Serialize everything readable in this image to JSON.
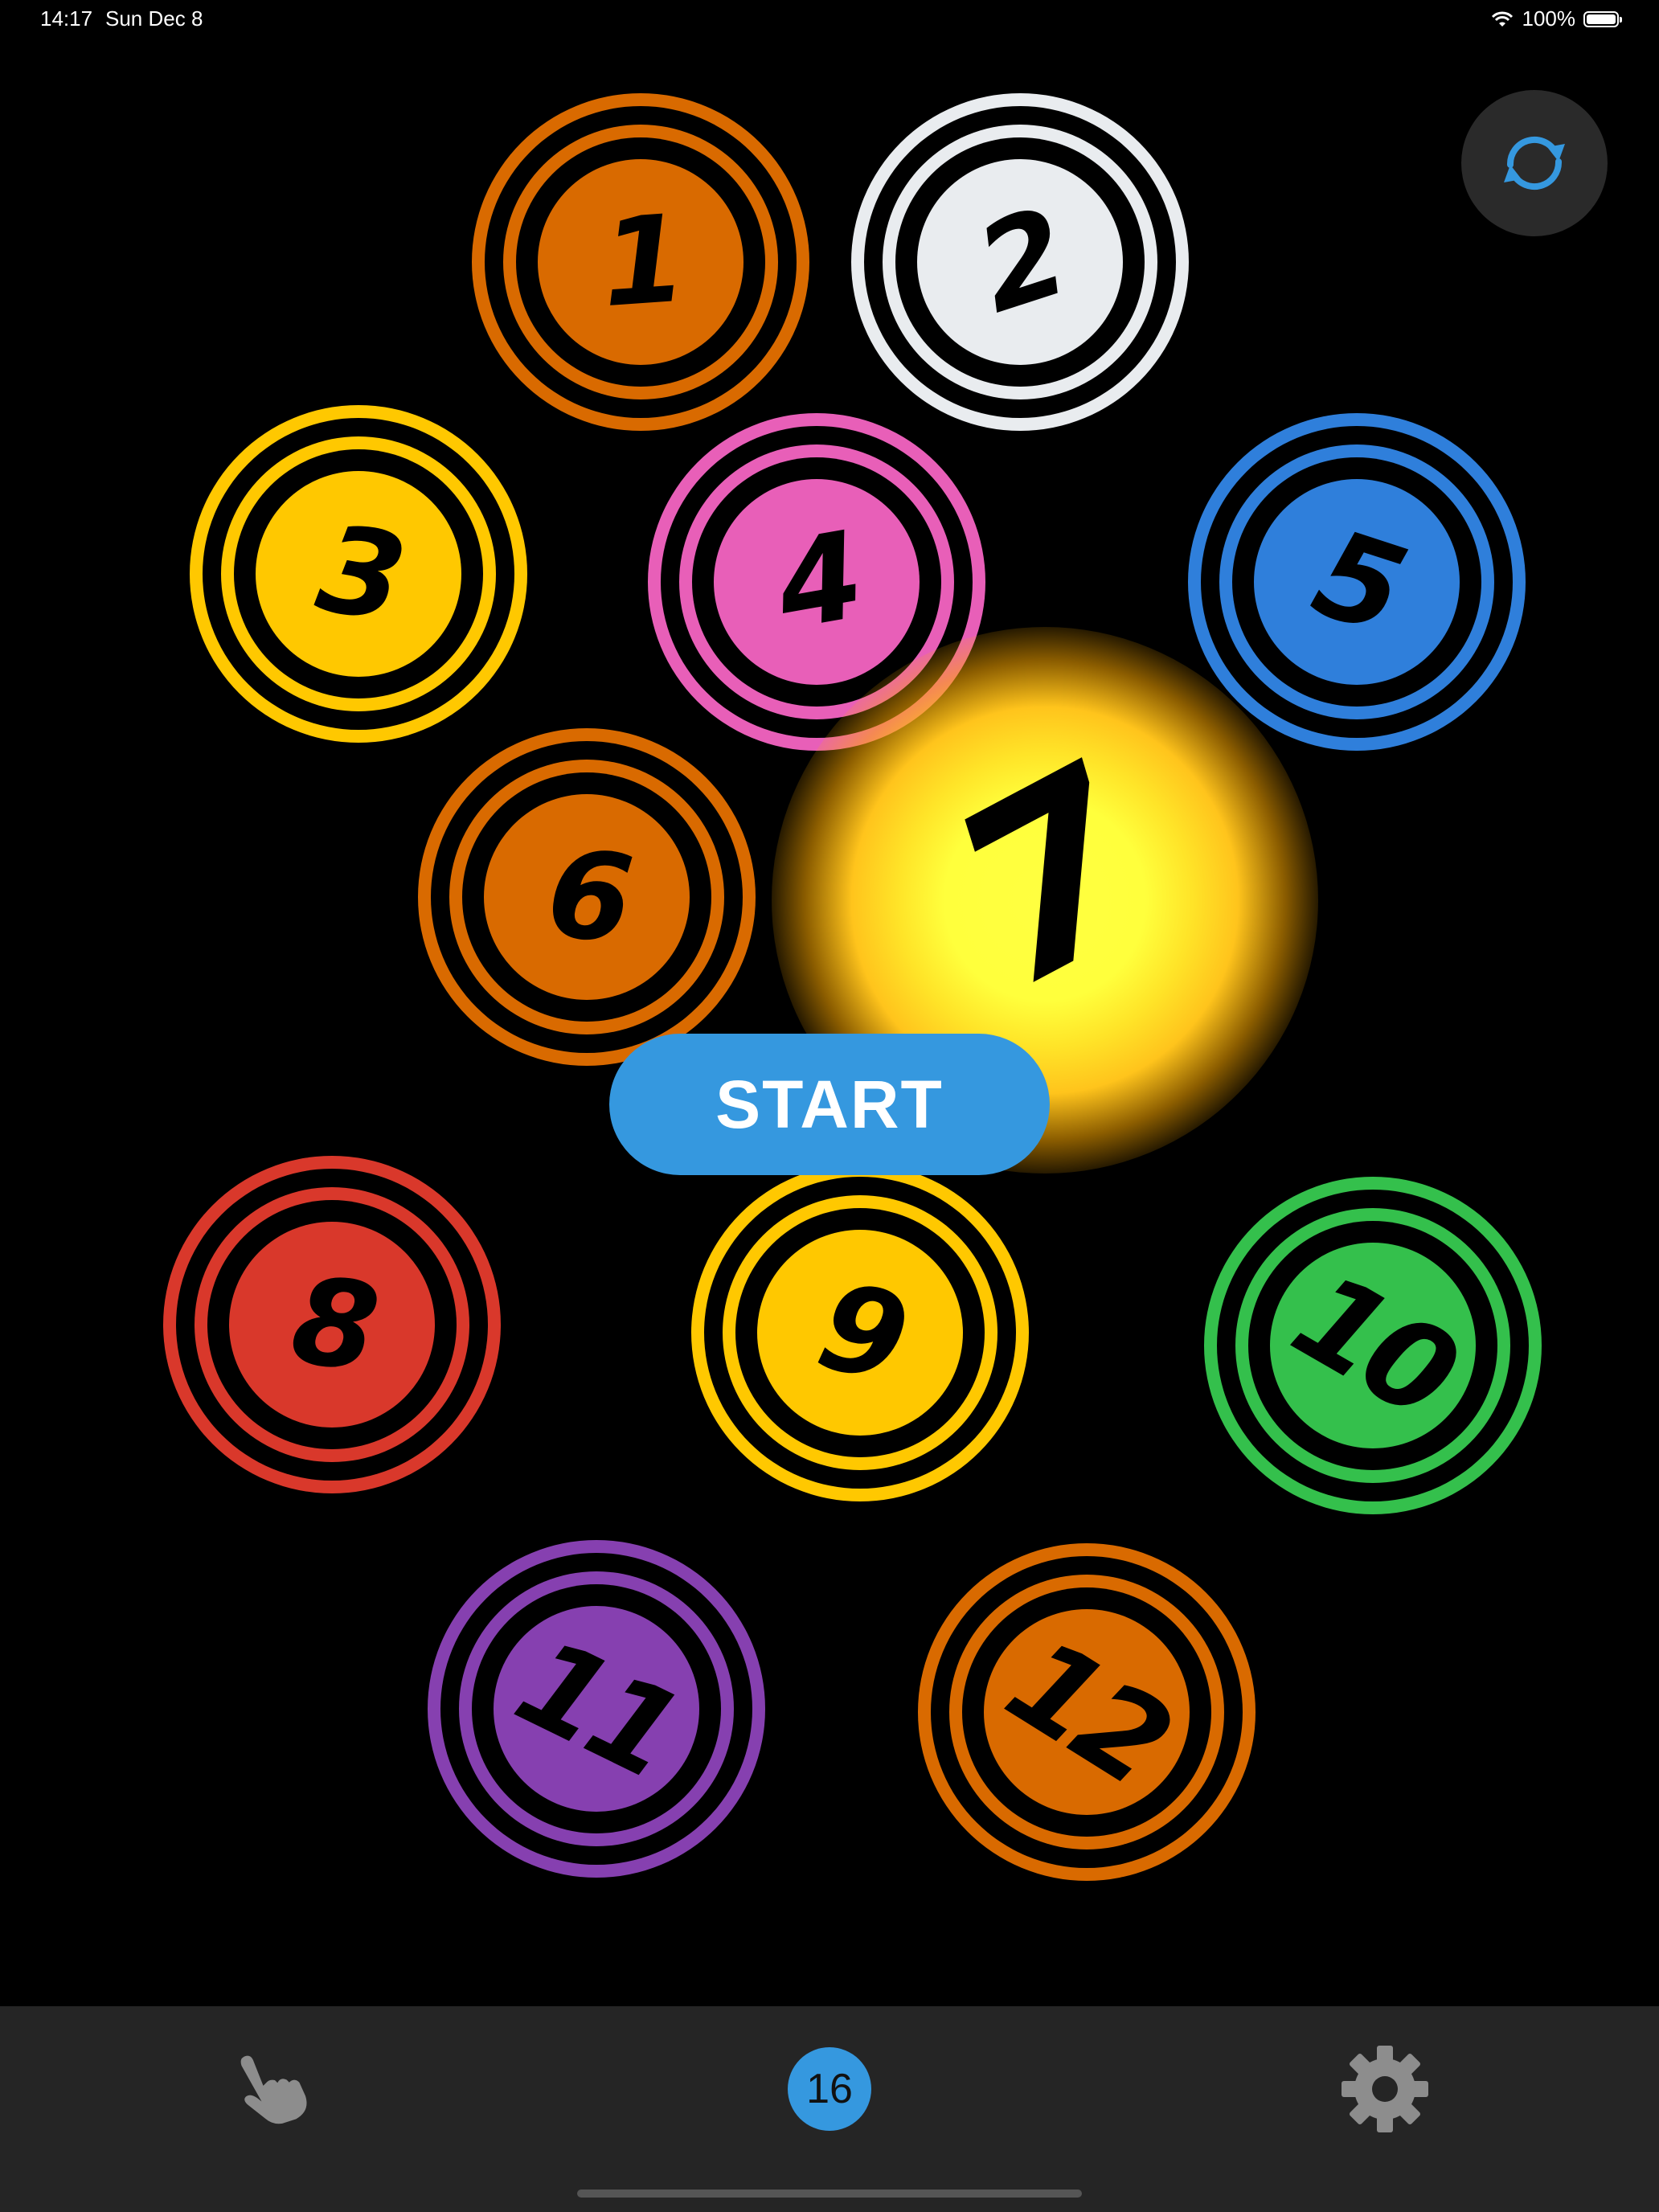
{
  "status_bar": {
    "time": "14:17",
    "date": "Sun Dec 8",
    "battery": "100%",
    "wifi_icon": "wifi-icon",
    "battery_icon": "battery-icon"
  },
  "reset": {
    "icon": "rotate-arrows-icon",
    "color": "#3598df"
  },
  "tokens": [
    {
      "label": "1",
      "color": "#d96a00"
    },
    {
      "label": "2",
      "color": "#e9ecef"
    },
    {
      "label": "3",
      "color": "#ffc800"
    },
    {
      "label": "4",
      "color": "#e85fb8"
    },
    {
      "label": "5",
      "color": "#2f7fdb"
    },
    {
      "label": "6",
      "color": "#d96a00"
    },
    {
      "label": "8",
      "color": "#d9382b"
    },
    {
      "label": "9",
      "color": "#ffc800"
    },
    {
      "label": "10",
      "color": "#34c04c"
    },
    {
      "label": "11",
      "color": "#8640b0"
    },
    {
      "label": "12",
      "color": "#d96a00"
    }
  ],
  "highlighted_token": {
    "label": "7",
    "color": "#ffff40"
  },
  "start_button": {
    "label": "START",
    "color": "#3598df"
  },
  "tab_bar": {
    "touch_icon": "hand-pointer-icon",
    "count": "16",
    "settings_icon": "gear-icon"
  }
}
